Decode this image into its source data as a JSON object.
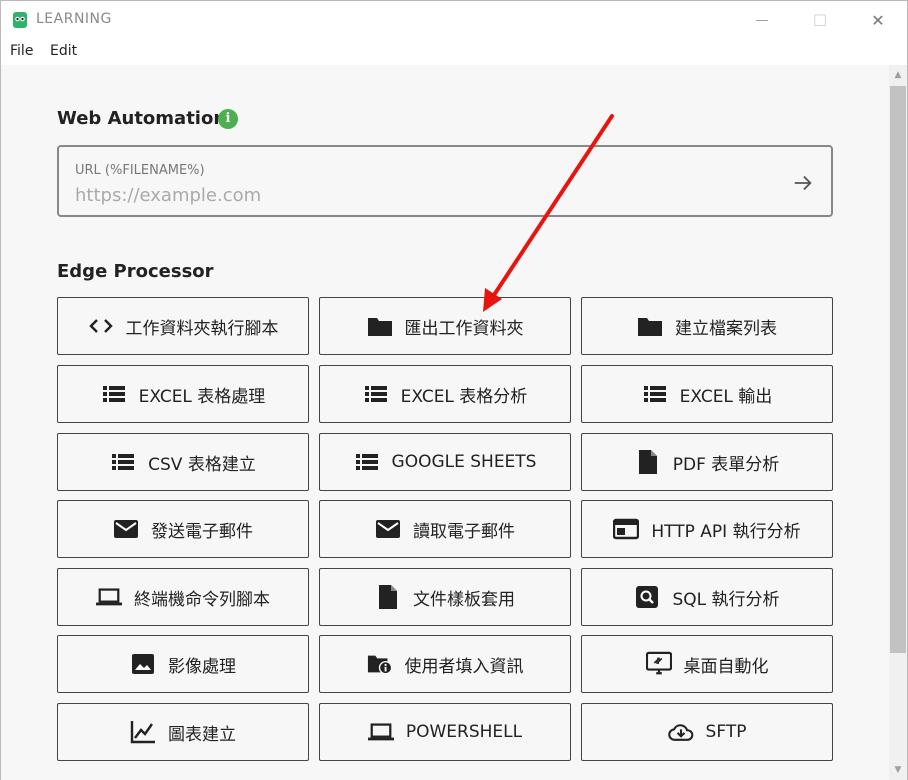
{
  "window": {
    "title": "LEARNING",
    "minimize_glyph": "—",
    "maximize_glyph": "☐",
    "close_glyph": "✕"
  },
  "menu": {
    "file": "File",
    "edit": "Edit"
  },
  "web_automation": {
    "title": "Web Automation",
    "info_glyph": "i",
    "url_label": "URL (%FILENAME%)",
    "url_placeholder": "https://example.com",
    "url_value": ""
  },
  "edge_processor": {
    "title": "Edge Processor",
    "items": [
      {
        "label": "工作資料夾執行腳本",
        "icon": "code-icon"
      },
      {
        "label": "匯出工作資料夾",
        "icon": "folder-icon"
      },
      {
        "label": "建立檔案列表",
        "icon": "folder-icon"
      },
      {
        "label": "EXCEL 表格處理",
        "icon": "list-icon"
      },
      {
        "label": "EXCEL 表格分析",
        "icon": "list-icon"
      },
      {
        "label": "EXCEL 輸出",
        "icon": "list-icon"
      },
      {
        "label": "CSV 表格建立",
        "icon": "list-icon"
      },
      {
        "label": "GOOGLE SHEETS",
        "icon": "list-icon"
      },
      {
        "label": "PDF 表單分析",
        "icon": "document-icon"
      },
      {
        "label": "發送電子郵件",
        "icon": "mail-icon"
      },
      {
        "label": "讀取電子郵件",
        "icon": "mail-icon"
      },
      {
        "label": "HTTP API 執行分析",
        "icon": "web-window-icon"
      },
      {
        "label": "終端機命令列腳本",
        "icon": "laptop-icon"
      },
      {
        "label": "文件樣板套用",
        "icon": "document-icon"
      },
      {
        "label": "SQL 執行分析",
        "icon": "search-box-icon"
      },
      {
        "label": "影像處理",
        "icon": "image-icon"
      },
      {
        "label": "使用者填入資訊",
        "icon": "folder-info-icon"
      },
      {
        "label": "桌面自動化",
        "icon": "remote-desktop-icon"
      },
      {
        "label": "圖表建立",
        "icon": "line-chart-icon"
      },
      {
        "label": "POWERSHELL",
        "icon": "laptop-icon"
      },
      {
        "label": "SFTP",
        "icon": "cloud-download-icon"
      }
    ]
  },
  "annotation": {
    "arrow_color": "#e8140f"
  },
  "colors": {
    "info_badge": "#4caf50",
    "content_bg": "#f7f7f7"
  }
}
